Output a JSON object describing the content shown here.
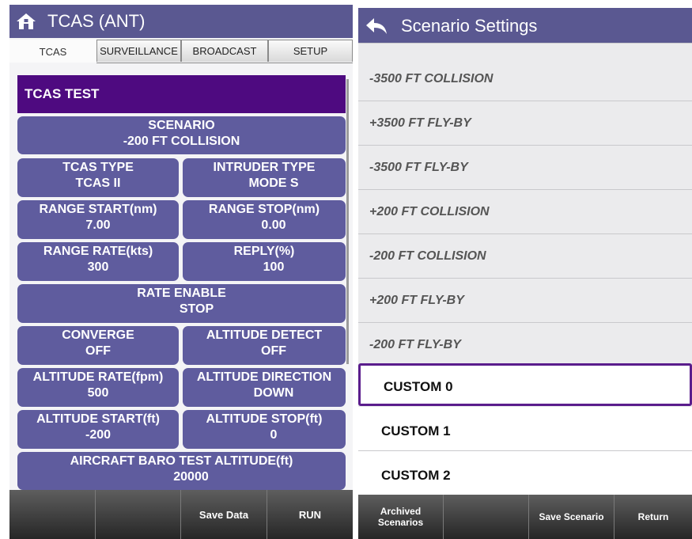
{
  "left": {
    "title": "TCAS (ANT)",
    "tabs": [
      "TCAS",
      "SURVEILLANCE",
      "BROADCAST",
      "SETUP"
    ],
    "section_title": "TCAS TEST",
    "scenario": {
      "label": "SCENARIO",
      "value": "-200 FT COLLISION"
    },
    "tcas_type": {
      "label": "TCAS TYPE",
      "value": "TCAS II"
    },
    "intruder_type": {
      "label": "INTRUDER TYPE",
      "value": "MODE S"
    },
    "range_start": {
      "label": "RANGE START(nm)",
      "value": "7.00"
    },
    "range_stop": {
      "label": "RANGE STOP(nm)",
      "value": "0.00"
    },
    "range_rate": {
      "label": "RANGE RATE(kts)",
      "value": "300"
    },
    "reply": {
      "label": "REPLY(%)",
      "value": "100"
    },
    "rate_enable": {
      "label": "RATE ENABLE",
      "value": "STOP"
    },
    "converge": {
      "label": "CONVERGE",
      "value": "OFF"
    },
    "altitude_detect": {
      "label": "ALTITUDE DETECT",
      "value": "OFF"
    },
    "altitude_rate": {
      "label": "ALTITUDE RATE(fpm)",
      "value": "500"
    },
    "altitude_direction": {
      "label": "ALTITUDE DIRECTION",
      "value": "DOWN"
    },
    "altitude_start": {
      "label": "ALTITUDE START(ft)",
      "value": "-200"
    },
    "altitude_stop": {
      "label": "ALTITUDE STOP(ft)",
      "value": "0"
    },
    "baro": {
      "label": "AIRCRAFT BARO TEST ALTITUDE(ft)",
      "value": "20000"
    },
    "footer": {
      "blank1": "",
      "blank2": "",
      "save_data": "Save Data",
      "run": "RUN"
    }
  },
  "right": {
    "title": "Scenario Settings",
    "items": [
      "-3500 FT COLLISION",
      "+3500 FT FLY-BY",
      "-3500 FT FLY-BY",
      "+200 FT COLLISION",
      "-200 FT COLLISION",
      "+200 FT FLY-BY",
      "-200 FT FLY-BY",
      "CUSTOM 0",
      "CUSTOM 1",
      "CUSTOM 2"
    ],
    "selected_index": 7,
    "footer": {
      "archived_line1": "Archived",
      "archived_line2": "Scenarios",
      "blank": "",
      "save_scenario": "Save Scenario",
      "return": "Return"
    }
  },
  "colors": {
    "header": "#5a5891",
    "button": "#5f5c9e",
    "section": "#4e0a80",
    "selected_border": "#5a1d8c"
  },
  "icons": {
    "home": "home-icon",
    "back": "back-arrow-icon"
  }
}
